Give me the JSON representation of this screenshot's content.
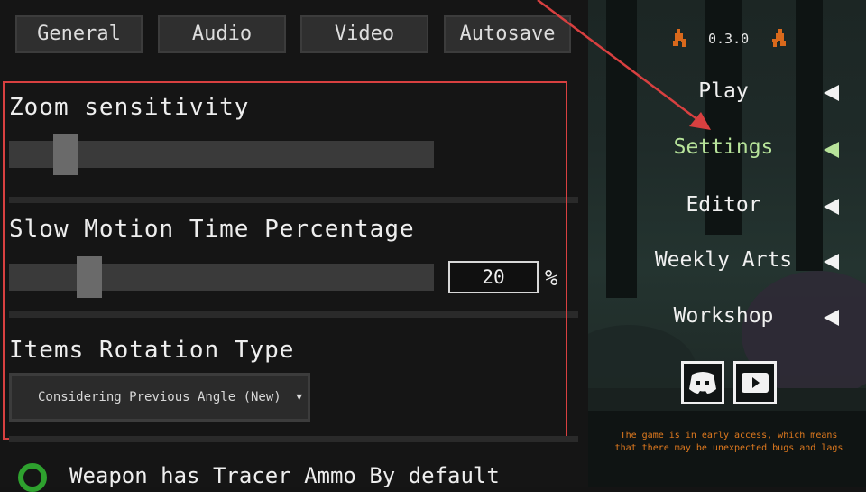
{
  "tabs": [
    {
      "label": "General"
    },
    {
      "label": "Audio"
    },
    {
      "label": "Video"
    },
    {
      "label": "Autosave"
    }
  ],
  "settings": {
    "zoom": {
      "title": "Zoom sensitivity",
      "level": 0.11
    },
    "slow_motion": {
      "title": "Slow Motion Time Percentage",
      "value": "20",
      "unit": "%",
      "level": 0.17
    },
    "rotation": {
      "title": "Items Rotation Type",
      "selected": "Considering Previous Angle (New)"
    },
    "tracer": {
      "label": "Weapon has Tracer Ammo By default",
      "checked": true
    }
  },
  "menu": {
    "version": "0.3.0",
    "items": [
      {
        "label": "Play",
        "active": false
      },
      {
        "label": "Settings",
        "active": true
      },
      {
        "label": "Editor",
        "active": false
      },
      {
        "label": "Weekly Arts",
        "active": false
      },
      {
        "label": "Workshop",
        "active": false
      }
    ],
    "social": [
      {
        "icon": "discord-icon"
      },
      {
        "icon": "youtube-icon"
      }
    ],
    "notice": "The game is in early access, which means that there may be unexpected bugs and lags"
  },
  "colors": {
    "active_menu": "#b7e39a",
    "annotation": "#d84040",
    "notice": "#e07a1f",
    "checkbox": "#2ea12e"
  }
}
